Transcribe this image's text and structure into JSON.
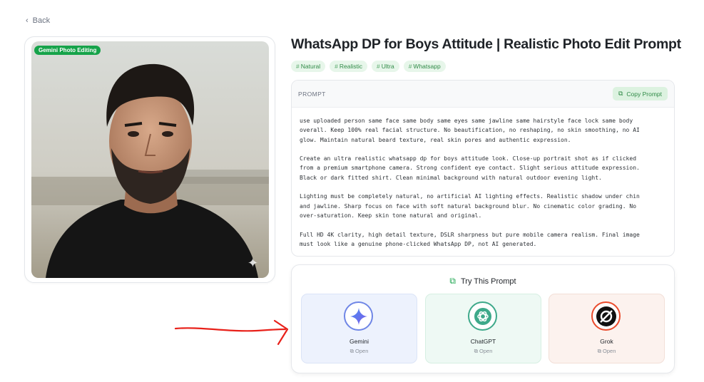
{
  "nav": {
    "back_label": "Back",
    "back_icon": "chevron-left-icon"
  },
  "photo": {
    "badge": "Gemini Photo Editing",
    "sparkle_icon": "sparkle-icon"
  },
  "title": "WhatsApp DP for Boys Attitude | Realistic Photo Edit Prompt",
  "tags": [
    {
      "label": "Natural"
    },
    {
      "label": "Realistic"
    },
    {
      "label": "Ultra"
    },
    {
      "label": "Whatsapp"
    }
  ],
  "prompt": {
    "label": "PROMPT",
    "copy_label": "Copy Prompt",
    "text": "use uploaded person same face same body same eyes same jawline same hairstyle face lock same body\noverall. Keep 100% real facial structure. No beautification, no reshaping, no skin smoothing, no AI\nglow. Maintain natural beard texture, real skin pores and authentic expression.\n\nCreate an ultra realistic whatsapp dp for boys attitude look. Close-up portrait shot as if clicked\nfrom a premium smartphone camera. Strong confident eye contact. Slight serious attitude expression.\nBlack or dark fitted shirt. Clean minimal background with natural outdoor evening light.\n\nLighting must be completely natural, no artificial AI lighting effects. Realistic shadow under chin\nand jawline. Sharp focus on face with soft natural background blur. No cinematic color grading. No\nover-saturation. Keep skin tone natural and original.\n\nFull HD 4K clarity, high detail texture, DSLR sharpness but pure mobile camera realism. Final image\nmust look like a genuine phone-clicked WhatsApp DP, not AI generated."
  },
  "try": {
    "title": "Try This Prompt",
    "services": [
      {
        "name": "Gemini",
        "open": "Open",
        "accent": "#6f86e6"
      },
      {
        "name": "ChatGPT",
        "open": "Open",
        "accent": "#3ea98a"
      },
      {
        "name": "Grok",
        "open": "Open",
        "accent": "#ea4b2c"
      }
    ]
  },
  "colors": {
    "brand_green": "#16a34a",
    "annotation_red": "#e8211a"
  }
}
